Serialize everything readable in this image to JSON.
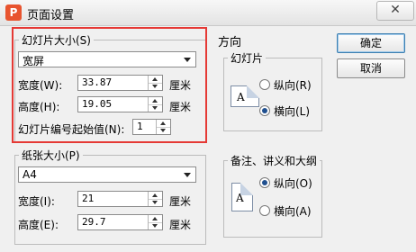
{
  "window": {
    "title": "页面设置",
    "app_icon": "P",
    "close_symbol": "✕"
  },
  "slide_size": {
    "legend": "幻灯片大小(S)",
    "preset": "宽屏",
    "width_label": "宽度(W):",
    "width_value": "33.87",
    "height_label": "高度(H):",
    "height_value": "19.05",
    "unit": "厘米",
    "start_label": "幻灯片编号起始值(N):",
    "start_value": "1"
  },
  "paper_size": {
    "legend": "纸张大小(P)",
    "preset": "A4",
    "width_label": "宽度(I):",
    "width_value": "21",
    "height_label": "高度(E):",
    "height_value": "29.7",
    "unit": "厘米"
  },
  "orientation": {
    "title": "方向",
    "slides": {
      "legend": "幻灯片",
      "portrait": "纵向(R)",
      "landscape": "横向(L)",
      "selected": "landscape"
    },
    "notes": {
      "legend": "备注、讲义和大纲",
      "portrait": "纵向(O)",
      "landscape": "横向(A)",
      "selected": "portrait"
    }
  },
  "buttons": {
    "ok": "确定",
    "cancel": "取消"
  },
  "colors": {
    "highlight": "#e53935",
    "app_icon": "#e8542f"
  },
  "icons": {
    "app": "wps-presentation-icon",
    "close": "close-icon",
    "page_landscape": "landscape-page-icon",
    "page_portrait": "portrait-page-icon"
  }
}
